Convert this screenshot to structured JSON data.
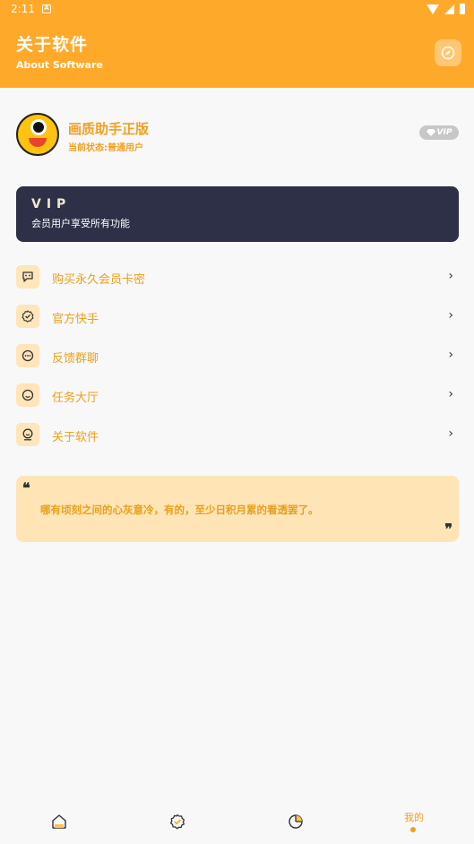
{
  "statusbar": {
    "time": "2:11",
    "app_icon_letter": "A"
  },
  "header": {
    "title": "关于软件",
    "subtitle": "About Software",
    "action_icon": "compass-icon",
    "bg_color": "#ffa92a"
  },
  "profile": {
    "app_name": "画质助手正版",
    "status": "当前状态:普通用户",
    "badge": "VIP"
  },
  "vip_card": {
    "title": "VIP",
    "description": "会员用户享受所有功能"
  },
  "menu": {
    "items": [
      {
        "label": "购买永久会员卡密",
        "icon": "chat-icon"
      },
      {
        "label": "官方快手",
        "icon": "badge-check-icon"
      },
      {
        "label": "反馈群聊",
        "icon": "message-dots-icon"
      },
      {
        "label": "任务大厅",
        "icon": "smile-icon"
      },
      {
        "label": "关于软件",
        "icon": "user-circle-icon"
      }
    ],
    "chevron": "›"
  },
  "quote": {
    "text": "哪有顷刻之间的心灰意冷，有的，至少日积月累的看透罢了。",
    "open_mark": "❝",
    "close_mark": "❞"
  },
  "bottom_nav": {
    "tabs": [
      {
        "icon": "home-icon"
      },
      {
        "icon": "badge-check-icon"
      },
      {
        "icon": "pie-chart-icon"
      },
      {
        "label": "我的",
        "active": true
      }
    ]
  },
  "colors": {
    "accent": "#ffa92a",
    "text_accent": "#eca11c",
    "card_dark": "#2d3046",
    "quote_bg": "#ffe4b5"
  }
}
